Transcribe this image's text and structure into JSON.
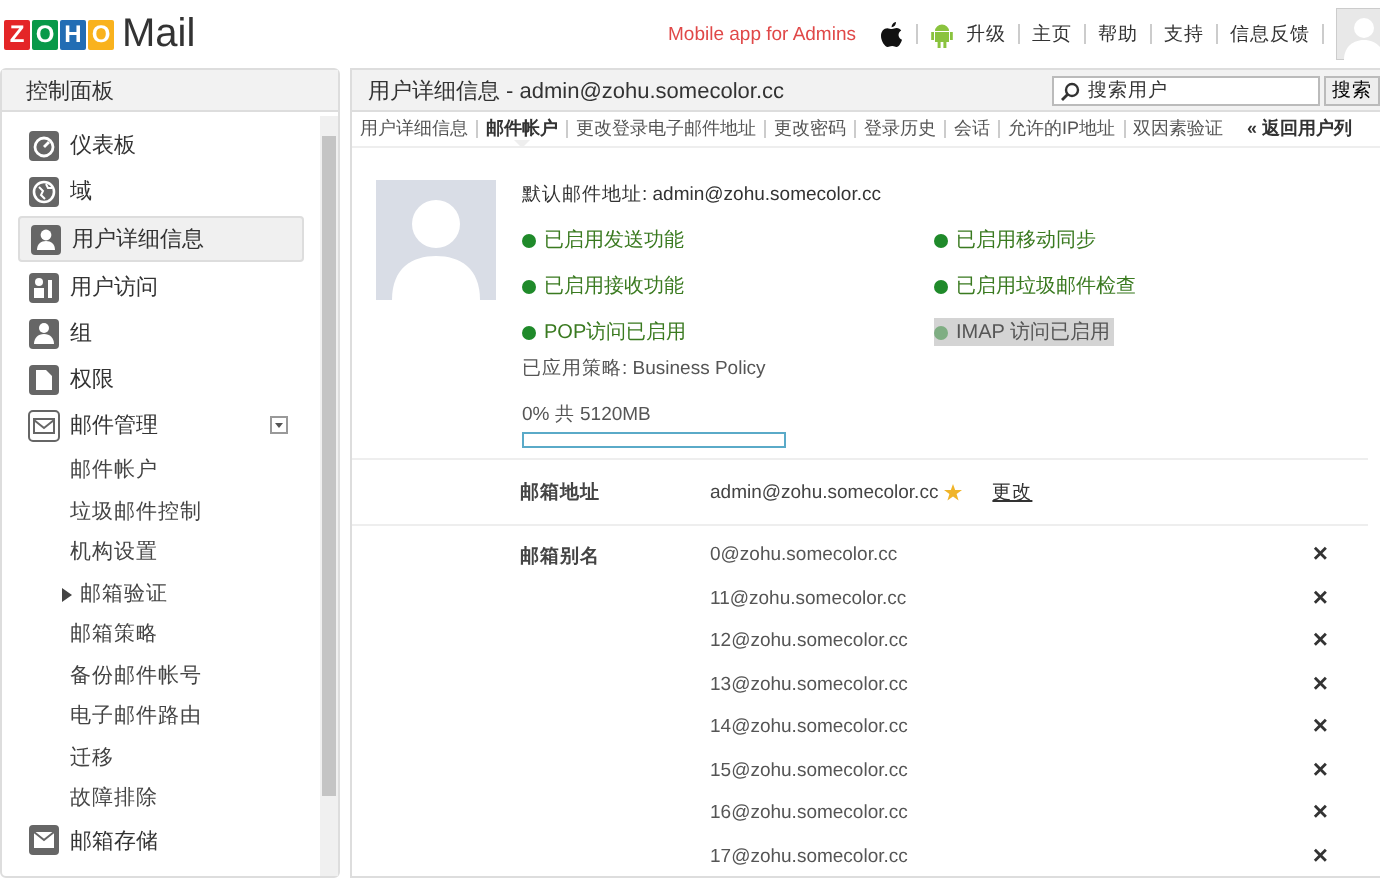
{
  "header": {
    "logo_letters": [
      "Z",
      "O",
      "H",
      "O"
    ],
    "logo_word": "Mail",
    "mobile_app": "Mobile app for Admins",
    "links": [
      "升级",
      "主页",
      "帮助",
      "支持",
      "信息反馈"
    ]
  },
  "sidebar": {
    "title": "控制面板",
    "items": [
      {
        "label": "仪表板",
        "kind": "dashboard",
        "selected": false
      },
      {
        "label": "域",
        "kind": "globe",
        "selected": false
      },
      {
        "label": "用户详细信息",
        "kind": "user",
        "selected": true
      },
      {
        "label": "用户访问",
        "kind": "access",
        "selected": false
      },
      {
        "label": "组",
        "kind": "group",
        "selected": false
      },
      {
        "label": "权限",
        "kind": "doc",
        "selected": false
      },
      {
        "label": "邮件管理",
        "kind": "mail",
        "selected": false,
        "expanded": true,
        "children": [
          {
            "label": "邮件帐户",
            "expandable": false
          },
          {
            "label": "垃圾邮件控制",
            "expandable": false
          },
          {
            "label": "机构设置",
            "expandable": false
          },
          {
            "label": "邮箱验证",
            "expandable": true
          },
          {
            "label": "邮箱策略",
            "expandable": false
          },
          {
            "label": "备份邮件帐号",
            "expandable": false
          },
          {
            "label": "电子邮件路由",
            "expandable": false
          },
          {
            "label": "迁移",
            "expandable": false
          },
          {
            "label": "故障排除",
            "expandable": false
          }
        ]
      },
      {
        "label": "邮箱存储",
        "kind": "storage",
        "selected": false
      }
    ]
  },
  "main": {
    "title": "用户详细信息 - admin@zohu.somecolor.cc",
    "search": {
      "placeholder": "搜索用户",
      "button": "搜索"
    },
    "tabs": [
      {
        "label": "用户详细信息",
        "selected": false
      },
      {
        "label": "邮件帐户",
        "selected": true
      },
      {
        "label": "更改登录电子邮件地址",
        "selected": false
      },
      {
        "label": "更改密码",
        "selected": false
      },
      {
        "label": "登录历史",
        "selected": false
      },
      {
        "label": "会话",
        "selected": false
      },
      {
        "label": "允许的IP地址",
        "selected": false
      },
      {
        "label": "双因素验证",
        "selected": false
      }
    ],
    "back_link": "« 返回用户列",
    "default_address": "默认邮件地址: admin@zohu.somecolor.cc",
    "features": [
      {
        "label": "已启用发送功能",
        "on": true
      },
      {
        "label": "已启用移动同步",
        "on": true
      },
      {
        "label": "已启用接收功能",
        "on": true
      },
      {
        "label": "已启用垃圾邮件检查",
        "on": true
      },
      {
        "label": "POP访问已启用",
        "on": true
      },
      {
        "label": "IMAP 访问已启用",
        "on": false
      }
    ],
    "policy": "已应用策略:  Business Policy",
    "quota": {
      "reading": "0% 共 5120MB",
      "level": 0
    },
    "mailbox_address": {
      "label": "邮箱地址",
      "value": "admin@zohu.somecolor.cc",
      "primary": true,
      "action": "更改"
    },
    "aliases": {
      "label": "邮箱别名",
      "items": [
        "0@zohu.somecolor.cc",
        "11@zohu.somecolor.cc",
        "12@zohu.somecolor.cc",
        "13@zohu.somecolor.cc",
        "14@zohu.somecolor.cc",
        "15@zohu.somecolor.cc",
        "16@zohu.somecolor.cc",
        "17@zohu.somecolor.cc"
      ],
      "remove": "×"
    }
  }
}
